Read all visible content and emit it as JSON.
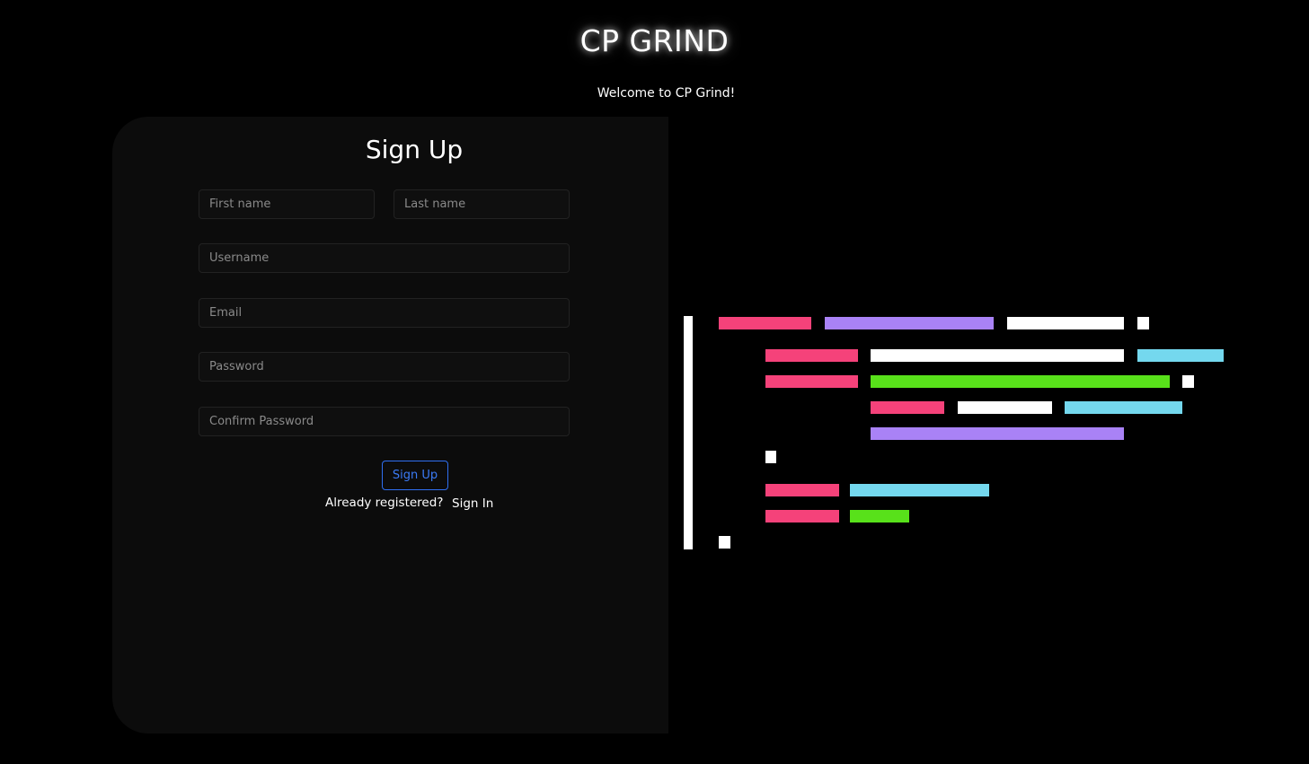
{
  "brand": "CP GRIND",
  "welcome": "Welcome to CP Grind!",
  "signup_form": {
    "title": "Sign Up",
    "first_name_placeholder": "First name",
    "last_name_placeholder": "Last name",
    "username_placeholder": "Username",
    "email_placeholder": "Email",
    "password_placeholder": "Password",
    "confirm_password_placeholder": "Confirm Password",
    "submit_label": "Sign Up",
    "already_registered": "Already registered?",
    "signin_label": "Sign In"
  },
  "colors": {
    "background": "#000000",
    "card": "#0c0c0c",
    "accent": "#3b7bf6",
    "code_pink": "#f5427a",
    "code_purple": "#a982f6",
    "code_white": "#ffffff",
    "code_cyan": "#74d8ee",
    "code_green": "#58e11a"
  }
}
